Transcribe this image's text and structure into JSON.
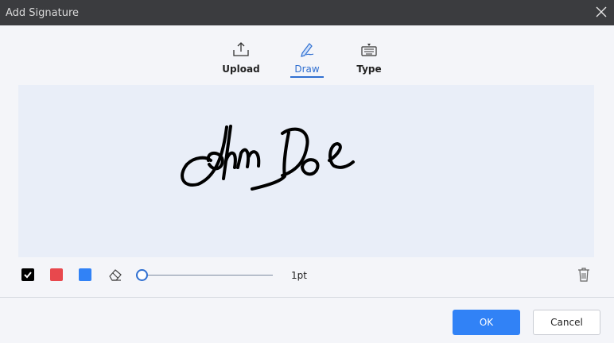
{
  "window": {
    "title": "Add Signature"
  },
  "tabs": [
    {
      "label": "Upload",
      "icon": "upload-icon",
      "active": false
    },
    {
      "label": "Draw",
      "icon": "pen-icon",
      "active": true
    },
    {
      "label": "Type",
      "icon": "keyboard-icon",
      "active": false
    }
  ],
  "canvas": {
    "background": "#e9eef8",
    "ink_color": "#000000"
  },
  "toolbar": {
    "colors": [
      {
        "name": "black",
        "hex": "#000000",
        "selected": true
      },
      {
        "name": "red",
        "hex": "#e8484d",
        "selected": false
      },
      {
        "name": "blue",
        "hex": "#3182f6",
        "selected": false
      }
    ],
    "eraser_icon": "eraser-icon",
    "stroke_size": 1,
    "stroke_size_label": "1pt",
    "trash_icon": "trash-icon"
  },
  "buttons": {
    "ok": "OK",
    "cancel": "Cancel"
  },
  "colors": {
    "accent": "#2f6fd1",
    "primary_button": "#3182f6",
    "titlebar": "#3b3c3f"
  }
}
